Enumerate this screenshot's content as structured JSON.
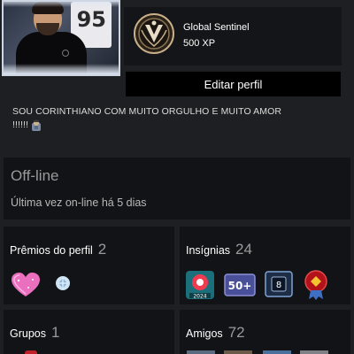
{
  "profile": {
    "avatar": {
      "icon": "user-avatar"
    },
    "level": {
      "rank_name": "Global Sentinel",
      "xp": "500 XP",
      "badge_icon": "rank-medal-icon"
    },
    "edit_button_label": "Editar perfil",
    "bio": {
      "line1": "SOU CORINTHIANO COM MUITO ORGULHO E MUITO AMOR",
      "line2": "!!!!!!",
      "emoji_icon": "emoji-icon"
    }
  },
  "status": {
    "title": "Off-line",
    "last_online": "Última vez on-line há 5 dias"
  },
  "sections": {
    "awards": {
      "title": "Prêmios do perfil",
      "count": "2",
      "items": [
        "pink-heart-award-icon",
        "crystal-award-icon"
      ]
    },
    "badges": {
      "title": "Insígnias",
      "count": "24",
      "items": [
        "steam-2024-badge-icon",
        "level-badge-icon",
        "years-badge-icon",
        "red-medal-badge-icon"
      ],
      "level_badge_text": "50+",
      "years_badge_text": "8",
      "steam_badge_text": "2024"
    },
    "groups": {
      "title": "Grupos",
      "count": "1"
    },
    "friends": {
      "title": "Amigos",
      "count": "72"
    }
  },
  "colors": {
    "background": "#1e1f22",
    "card": "#121316",
    "button": "#000000",
    "muted_text": "#9a9a9a"
  }
}
